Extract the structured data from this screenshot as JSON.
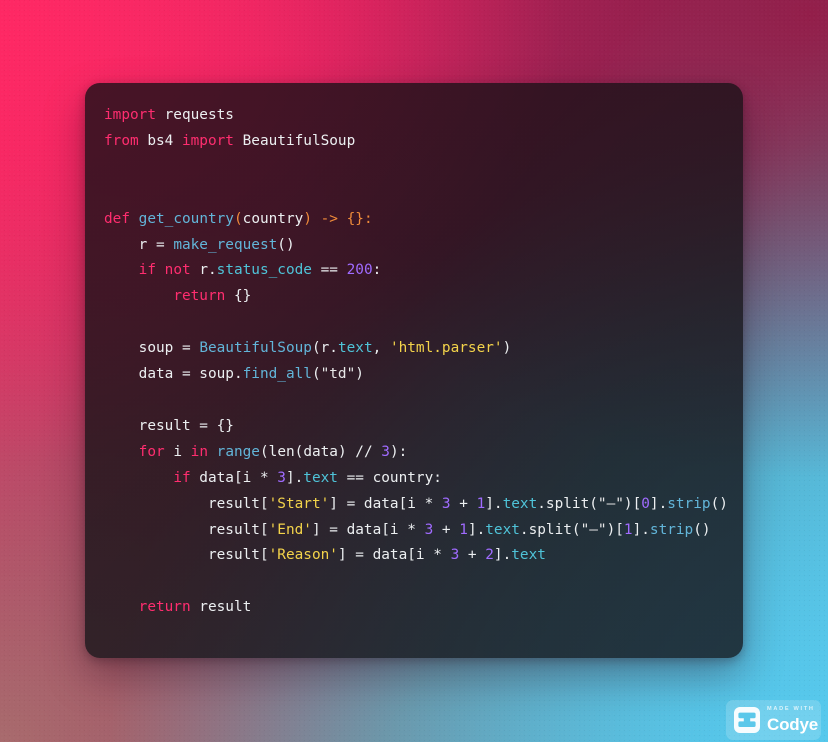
{
  "app": {
    "language": "python",
    "theme_background_colors": {
      "top_left": "#f62a63",
      "top_right": "#96194 6",
      "bottom_left": "#a86e6e",
      "bottom_right": "#56c8ec"
    },
    "card_background": "rgba(24,18,22,0.78)"
  },
  "watermark": {
    "made_with_label": "MADE WITH",
    "brand": "Codye",
    "logo_icon": "tray-logo-icon"
  },
  "syntax_colors": {
    "keyword": "#ff2d6f",
    "class_function": "#62b5d9",
    "attribute": "#4fc3d8",
    "string": "#f3d34a",
    "number": "#a06bff",
    "operator": "#f08b3a",
    "plain": "#eceff1"
  },
  "code": {
    "lines": [
      [
        {
          "t": "import",
          "c": "kw"
        },
        {
          "t": " requests",
          "c": "pl"
        }
      ],
      [
        {
          "t": "from",
          "c": "kw"
        },
        {
          "t": " bs4 ",
          "c": "pl"
        },
        {
          "t": "import",
          "c": "kw"
        },
        {
          "t": " BeautifulSoup",
          "c": "pl"
        }
      ],
      [],
      [],
      [
        {
          "t": "def",
          "c": "kw"
        },
        {
          "t": " ",
          "c": "pl"
        },
        {
          "t": "get_country",
          "c": "cls"
        },
        {
          "t": "(",
          "c": "op"
        },
        {
          "t": "country",
          "c": "pl"
        },
        {
          "t": ") -> {}",
          "c": "op"
        },
        {
          "t": ":",
          "c": "op"
        }
      ],
      [
        {
          "t": "    r = ",
          "c": "pl"
        },
        {
          "t": "make_request",
          "c": "cls"
        },
        {
          "t": "()",
          "c": "pl"
        }
      ],
      [
        {
          "t": "    ",
          "c": "pl"
        },
        {
          "t": "if",
          "c": "kw"
        },
        {
          "t": " ",
          "c": "pl"
        },
        {
          "t": "not",
          "c": "kw"
        },
        {
          "t": " r.",
          "c": "pl"
        },
        {
          "t": "status_code",
          "c": "attr"
        },
        {
          "t": " == ",
          "c": "pl"
        },
        {
          "t": "200",
          "c": "num"
        },
        {
          "t": ":",
          "c": "pl"
        }
      ],
      [
        {
          "t": "        ",
          "c": "pl"
        },
        {
          "t": "return",
          "c": "kw"
        },
        {
          "t": " {}",
          "c": "pl"
        }
      ],
      [],
      [
        {
          "t": "    soup = ",
          "c": "pl"
        },
        {
          "t": "BeautifulSoup",
          "c": "cls"
        },
        {
          "t": "(r.",
          "c": "pl"
        },
        {
          "t": "text",
          "c": "attr"
        },
        {
          "t": ", ",
          "c": "pl"
        },
        {
          "t": "'html.parser'",
          "c": "str"
        },
        {
          "t": ")",
          "c": "pl"
        }
      ],
      [
        {
          "t": "    data = soup.",
          "c": "pl"
        },
        {
          "t": "find_all",
          "c": "cls"
        },
        {
          "t": "(",
          "c": "pl"
        },
        {
          "t": "\"td\"",
          "c": "str2"
        },
        {
          "t": ")",
          "c": "pl"
        }
      ],
      [],
      [
        {
          "t": "    result = {}",
          "c": "pl"
        }
      ],
      [
        {
          "t": "    ",
          "c": "pl"
        },
        {
          "t": "for",
          "c": "kw"
        },
        {
          "t": " i ",
          "c": "pl"
        },
        {
          "t": "in",
          "c": "kw"
        },
        {
          "t": " ",
          "c": "pl"
        },
        {
          "t": "range",
          "c": "cls"
        },
        {
          "t": "(",
          "c": "pl"
        },
        {
          "t": "len",
          "c": "pl"
        },
        {
          "t": "(data) // ",
          "c": "pl"
        },
        {
          "t": "3",
          "c": "num"
        },
        {
          "t": "):",
          "c": "pl"
        }
      ],
      [
        {
          "t": "        ",
          "c": "pl"
        },
        {
          "t": "if",
          "c": "kw"
        },
        {
          "t": " data[i * ",
          "c": "pl"
        },
        {
          "t": "3",
          "c": "num"
        },
        {
          "t": "].",
          "c": "pl"
        },
        {
          "t": "text",
          "c": "attr"
        },
        {
          "t": " == country:",
          "c": "pl"
        }
      ],
      [
        {
          "t": "            result[",
          "c": "pl"
        },
        {
          "t": "'Start'",
          "c": "str"
        },
        {
          "t": "] = data[i * ",
          "c": "pl"
        },
        {
          "t": "3",
          "c": "num"
        },
        {
          "t": " + ",
          "c": "pl"
        },
        {
          "t": "1",
          "c": "num"
        },
        {
          "t": "].",
          "c": "pl"
        },
        {
          "t": "text",
          "c": "attr"
        },
        {
          "t": ".split(",
          "c": "pl"
        },
        {
          "t": "\"–\"",
          "c": "str2"
        },
        {
          "t": ")[",
          "c": "pl"
        },
        {
          "t": "0",
          "c": "num"
        },
        {
          "t": "].",
          "c": "pl"
        },
        {
          "t": "strip",
          "c": "cls"
        },
        {
          "t": "()",
          "c": "pl"
        }
      ],
      [
        {
          "t": "            result[",
          "c": "pl"
        },
        {
          "t": "'End'",
          "c": "str"
        },
        {
          "t": "] = data[i * ",
          "c": "pl"
        },
        {
          "t": "3",
          "c": "num"
        },
        {
          "t": " + ",
          "c": "pl"
        },
        {
          "t": "1",
          "c": "num"
        },
        {
          "t": "].",
          "c": "pl"
        },
        {
          "t": "text",
          "c": "attr"
        },
        {
          "t": ".split(",
          "c": "pl"
        },
        {
          "t": "\"–\"",
          "c": "str2"
        },
        {
          "t": ")[",
          "c": "pl"
        },
        {
          "t": "1",
          "c": "num"
        },
        {
          "t": "].",
          "c": "pl"
        },
        {
          "t": "strip",
          "c": "cls"
        },
        {
          "t": "()",
          "c": "pl"
        }
      ],
      [
        {
          "t": "            result[",
          "c": "pl"
        },
        {
          "t": "'Reason'",
          "c": "str"
        },
        {
          "t": "] = data[i * ",
          "c": "pl"
        },
        {
          "t": "3",
          "c": "num"
        },
        {
          "t": " + ",
          "c": "pl"
        },
        {
          "t": "2",
          "c": "num"
        },
        {
          "t": "].",
          "c": "pl"
        },
        {
          "t": "text",
          "c": "attr"
        }
      ],
      [],
      [
        {
          "t": "    ",
          "c": "pl"
        },
        {
          "t": "return",
          "c": "kw"
        },
        {
          "t": " result",
          "c": "pl"
        }
      ]
    ]
  }
}
